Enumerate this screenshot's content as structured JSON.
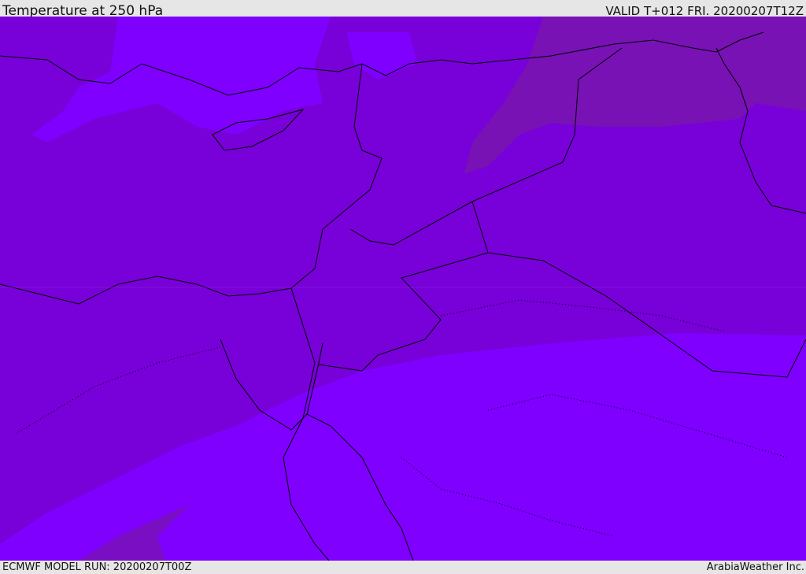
{
  "header": {
    "title": "Temperature at 250 hPa",
    "valid": "VALID T+012 FRI. 20200207T12Z"
  },
  "footer": {
    "model_run": "ECMWF MODEL RUN: 20200207T00Z",
    "credit": "ArabiaWeather Inc."
  },
  "colors": {
    "base": "#7800d8",
    "warm_band": "#7f00ff",
    "cool_band": "#7812b4",
    "coast": "#000000"
  }
}
